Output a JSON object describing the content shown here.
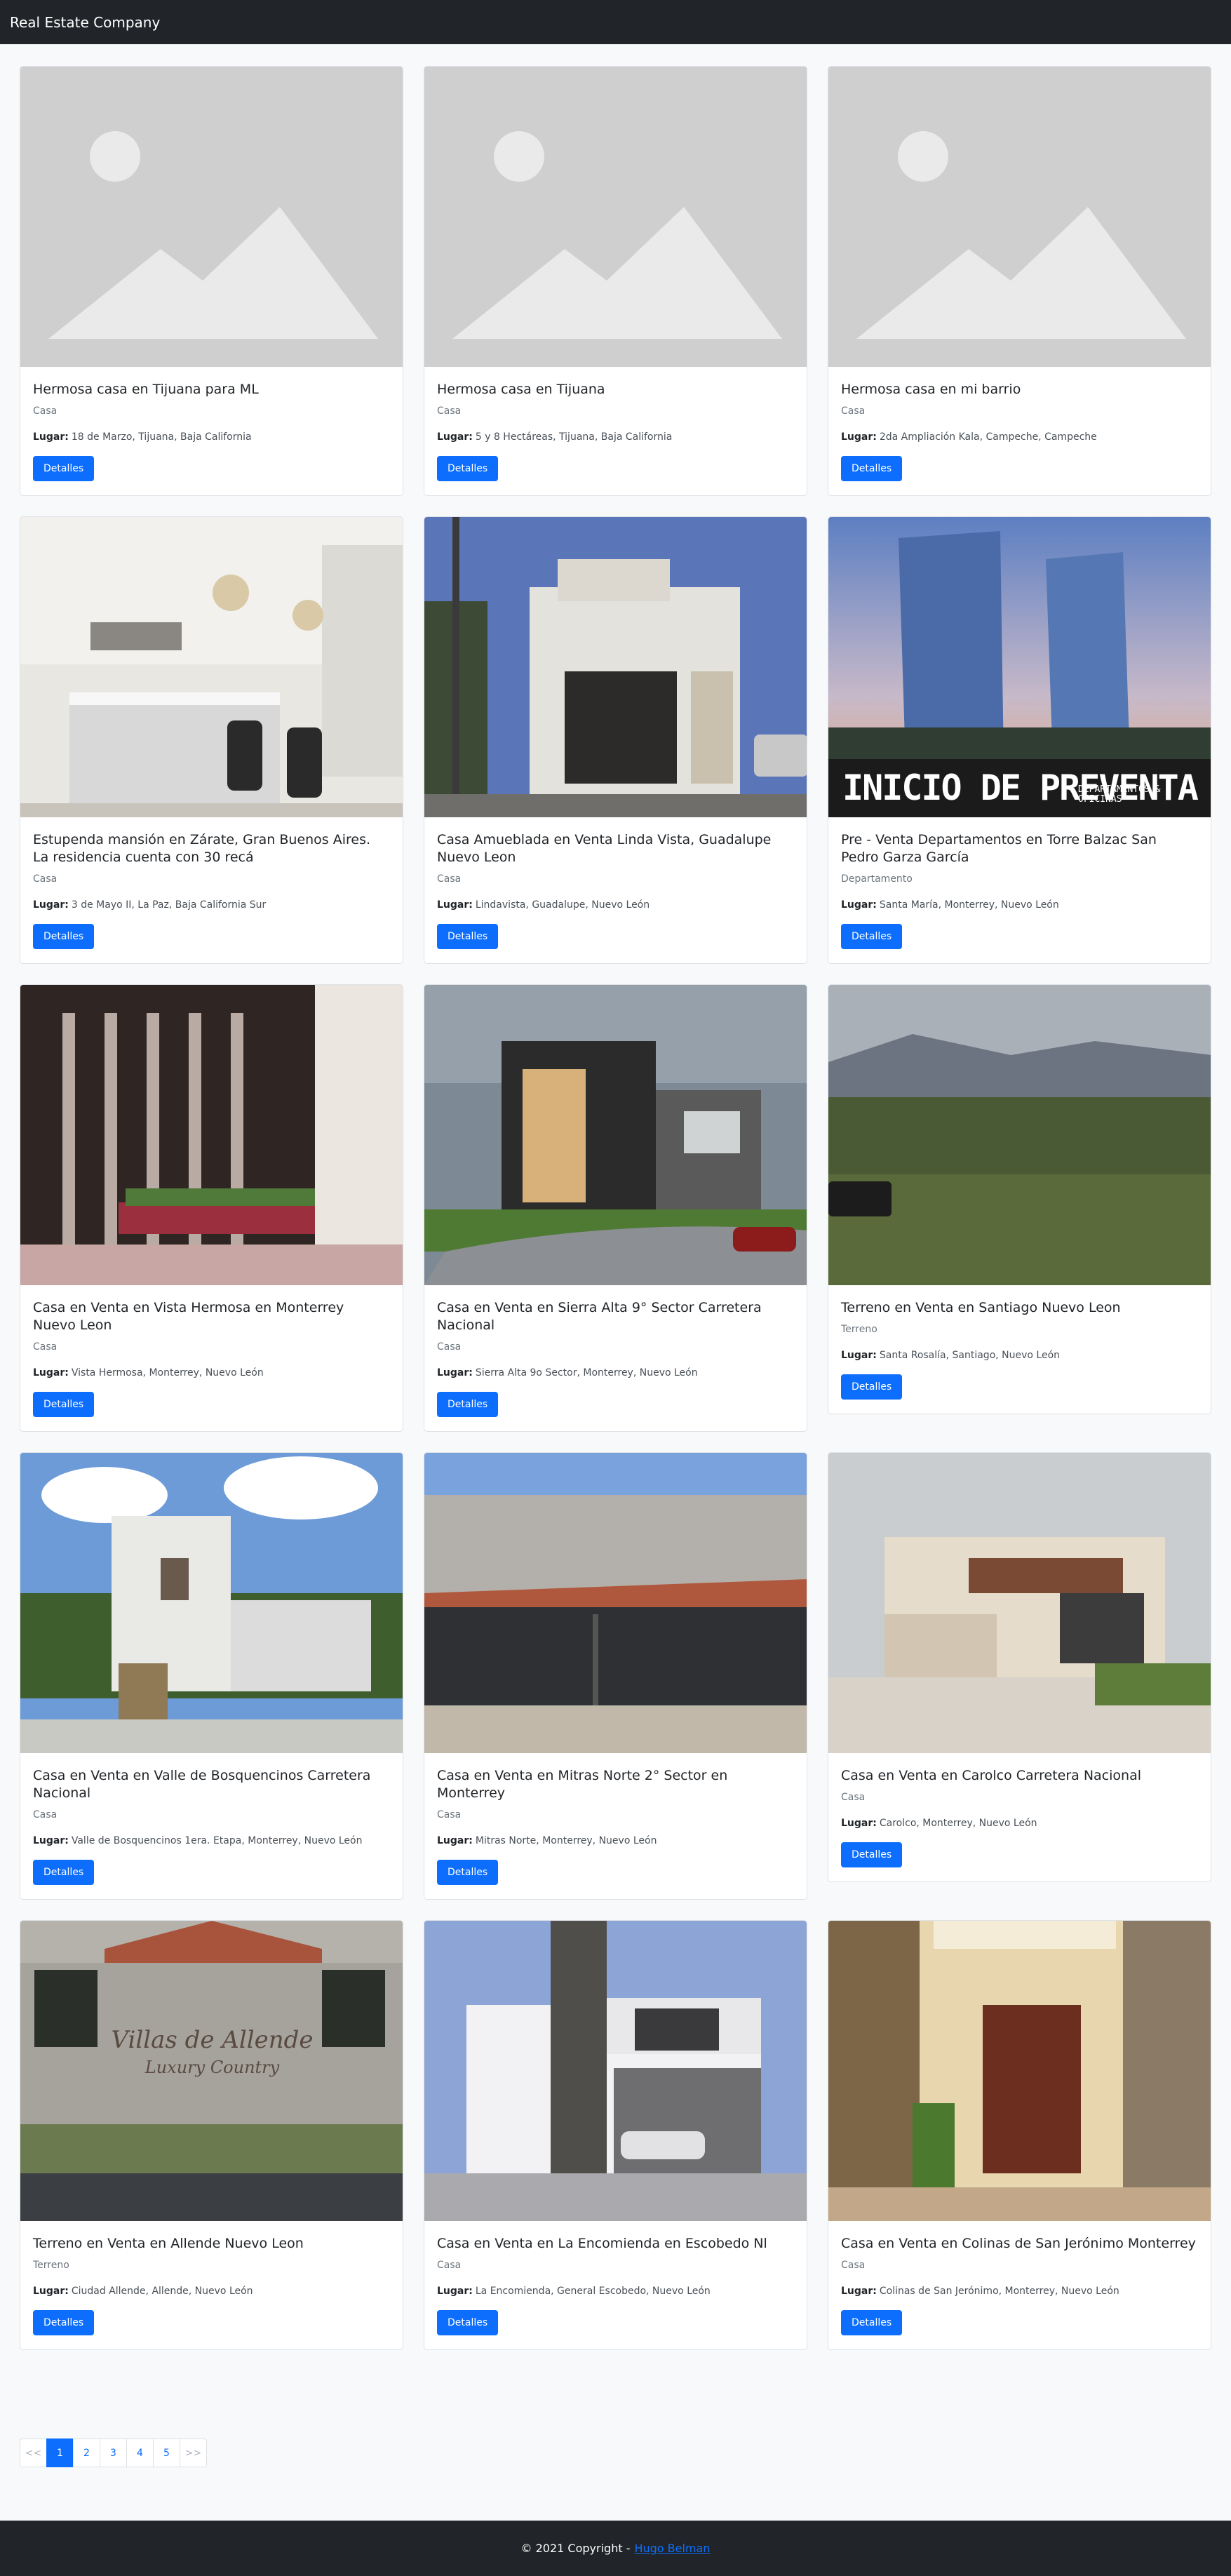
{
  "navbar": {
    "brand": "Real Estate Company"
  },
  "listings": [
    {
      "title": "Hermosa casa en Tijuana para ML",
      "type": "Casa",
      "location_label": "Lugar:",
      "location": "18 de Marzo, Tijuana, Baja California",
      "button": "Detalles",
      "image": "placeholder-image"
    },
    {
      "title": "Hermosa casa en Tijuana",
      "type": "Casa",
      "location_label": "Lugar:",
      "location": "5 y 8 Hectáreas, Tijuana, Baja California",
      "button": "Detalles",
      "image": "placeholder-image"
    },
    {
      "title": "Hermosa casa en mi barrio",
      "type": "Casa",
      "location_label": "Lugar:",
      "location": "2da Ampliación Kala, Campeche, Campeche",
      "button": "Detalles",
      "image": "placeholder-image"
    },
    {
      "title": "Estupenda mansión en Zárate, Gran Buenos Aires. La residencia cuenta con 30 recá",
      "type": "Casa",
      "location_label": "Lugar:",
      "location": "3 de Mayo II, La Paz, Baja California Sur",
      "button": "Detalles",
      "image": "kitchen-photo"
    },
    {
      "title": "Casa Amueblada en Venta Linda Vista, Guadalupe Nuevo Leon",
      "type": "Casa",
      "location_label": "Lugar:",
      "location": "Lindavista, Guadalupe, Nuevo León",
      "button": "Detalles",
      "image": "house-street-photo"
    },
    {
      "title": "Pre - Venta Departamentos en Torre Balzac San Pedro Garza García",
      "type": "Departamento",
      "location_label": "Lugar:",
      "location": "Santa María, Monterrey, Nuevo León",
      "button": "Detalles",
      "image": "towers-photo",
      "image_text": "INICIO DE PREVENTA",
      "image_subtext": "DEPARTAMENTOS & OFICINAS"
    },
    {
      "title": "Casa en Venta en Vista Hermosa en Monterrey Nuevo Leon",
      "type": "Casa",
      "location_label": "Lugar:",
      "location": "Vista Hermosa, Monterrey, Nuevo León",
      "button": "Detalles",
      "image": "gate-photo"
    },
    {
      "title": "Casa en Venta en Sierra Alta 9° Sector Carretera Nacional",
      "type": "Casa",
      "location_label": "Lugar:",
      "location": "Sierra Alta 9o Sector, Monterrey, Nuevo León",
      "button": "Detalles",
      "image": "modern-house-photo"
    },
    {
      "title": "Terreno en Venta en Santiago Nuevo Leon",
      "type": "Terreno",
      "location_label": "Lugar:",
      "location": "Santa Rosalía, Santiago, Nuevo León",
      "button": "Detalles",
      "image": "land-photo"
    },
    {
      "title": "Casa en Venta en Valle de Bosquencinos Carretera Nacional",
      "type": "Casa",
      "location_label": "Lugar:",
      "location": "Valle de Bosquencinos 1era. Etapa, Monterrey, Nuevo León",
      "button": "Detalles",
      "image": "white-house-photo"
    },
    {
      "title": "Casa en Venta en Mitras Norte 2° Sector en Monterrey",
      "type": "Casa",
      "location_label": "Lugar:",
      "location": "Mitras Norte, Monterrey, Nuevo León",
      "button": "Detalles",
      "image": "garage-photo"
    },
    {
      "title": "Casa en Venta en Carolco Carretera Nacional",
      "type": "Casa",
      "location_label": "Lugar:",
      "location": "Carolco, Monterrey, Nuevo León",
      "button": "Detalles",
      "image": "cream-house-photo"
    },
    {
      "title": "Terreno en Venta en Allende Nuevo Leon",
      "type": "Terreno",
      "location_label": "Lugar:",
      "location": "Ciudad Allende, Allende, Nuevo León",
      "button": "Detalles",
      "image": "entrance-sign-photo",
      "image_text": "Villas de Allende",
      "image_subtext": "Luxury Country"
    },
    {
      "title": "Casa en Venta en La Encomienda en Escobedo Nl",
      "type": "Casa",
      "location_label": "Lugar:",
      "location": "La Encomienda, General Escobedo, Nuevo León",
      "button": "Detalles",
      "image": "render-house-photo"
    },
    {
      "title": "Casa en Venta en Colinas de San Jerónimo Monterrey",
      "type": "Casa",
      "location_label": "Lugar:",
      "location": "Colinas de San Jerónimo, Monterrey, Nuevo León",
      "button": "Detalles",
      "image": "doorway-photo"
    }
  ],
  "pagination": {
    "pages": [
      "<<",
      "1",
      "2",
      "3",
      "4",
      "5",
      ">>"
    ],
    "active": "1"
  },
  "footer": {
    "text": "© 2021 Copyright -",
    "link": "Hugo Belman"
  },
  "colors": {
    "navbar": "#212529",
    "primary": "#0d6efd",
    "background": "#f8f9fa"
  }
}
